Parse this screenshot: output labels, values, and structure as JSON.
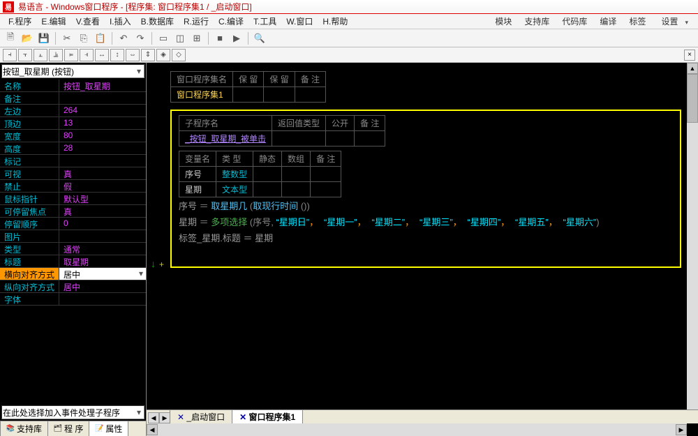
{
  "title": "易语言 - Windows窗口程序 - [程序集: 窗口程序集1 / _启动窗口]",
  "menus": [
    "F.程序",
    "E.编辑",
    "V.查看",
    "I.插入",
    "B.数据库",
    "R.运行",
    "C.编译",
    "T.工具",
    "W.窗口",
    "H.帮助"
  ],
  "right_menus": [
    "模块",
    "支持库",
    "代码库",
    "编译",
    "标签",
    "设置"
  ],
  "side_selector": "按钮_取星期 (按钮)",
  "properties": [
    {
      "name": "名称",
      "val": "按钮_取星期"
    },
    {
      "name": "备注",
      "val": ""
    },
    {
      "name": "左边",
      "val": "264"
    },
    {
      "name": "顶边",
      "val": "13"
    },
    {
      "name": "宽度",
      "val": "80"
    },
    {
      "name": "高度",
      "val": "28"
    },
    {
      "name": "标记",
      "val": ""
    },
    {
      "name": "可视",
      "val": "真"
    },
    {
      "name": "禁止",
      "val": "假"
    },
    {
      "name": "鼠标指针",
      "val": "默认型"
    },
    {
      "name": "可停留焦点",
      "val": "真"
    },
    {
      "name": "  停留顺序",
      "val": "0"
    },
    {
      "name": "图片",
      "val": ""
    },
    {
      "name": "类型",
      "val": "通常"
    },
    {
      "name": "标题",
      "val": "取星期"
    },
    {
      "name": "横向对齐方式",
      "val": "居中",
      "selected": true
    },
    {
      "name": "纵向对齐方式",
      "val": "居中"
    },
    {
      "name": "字体",
      "val": ""
    }
  ],
  "event_selector": "在此处选择加入事件处理子程序",
  "side_tabs": [
    "支持库",
    "程 序",
    "属性"
  ],
  "top_table": {
    "headers": [
      "窗口程序集名",
      "保 留",
      "保 留",
      "备 注"
    ],
    "row": "窗口程序集1"
  },
  "sub_table": {
    "headers": [
      "子程序名",
      "返回值类型",
      "公开",
      "备 注"
    ],
    "row": "_按钮_取星期_被单击"
  },
  "var_table": {
    "headers": [
      "变量名",
      "类 型",
      "静态",
      "数组",
      "备 注"
    ],
    "rows": [
      {
        "name": "序号",
        "type": "整数型"
      },
      {
        "name": "星期",
        "type": "文本型"
      }
    ]
  },
  "code": {
    "l1_a": "序号",
    "l1_eq": " ＝ ",
    "l1_b": "取星期几",
    "l1_c": " (",
    "l1_d": "取现行时间",
    "l1_e": " ())",
    "l2_a": "星期",
    "l2_eq": " ＝ ",
    "l2_b": "多项选择",
    "l2_c": " (序号, ",
    "l2_s0": "“星期日”",
    "l2_s1": "“星期一”",
    "l2_s2": "“星期二”",
    "l2_s3": "“星期三”",
    "l2_s4": "“星期四”",
    "l2_s5": "“星期五”",
    "l2_s6": "“星期六”",
    "l2_end": ")",
    "l3": "标签_星期.标题 ＝ 星期"
  },
  "bottom_tabs": [
    "_启动窗口",
    "窗口程序集1"
  ]
}
